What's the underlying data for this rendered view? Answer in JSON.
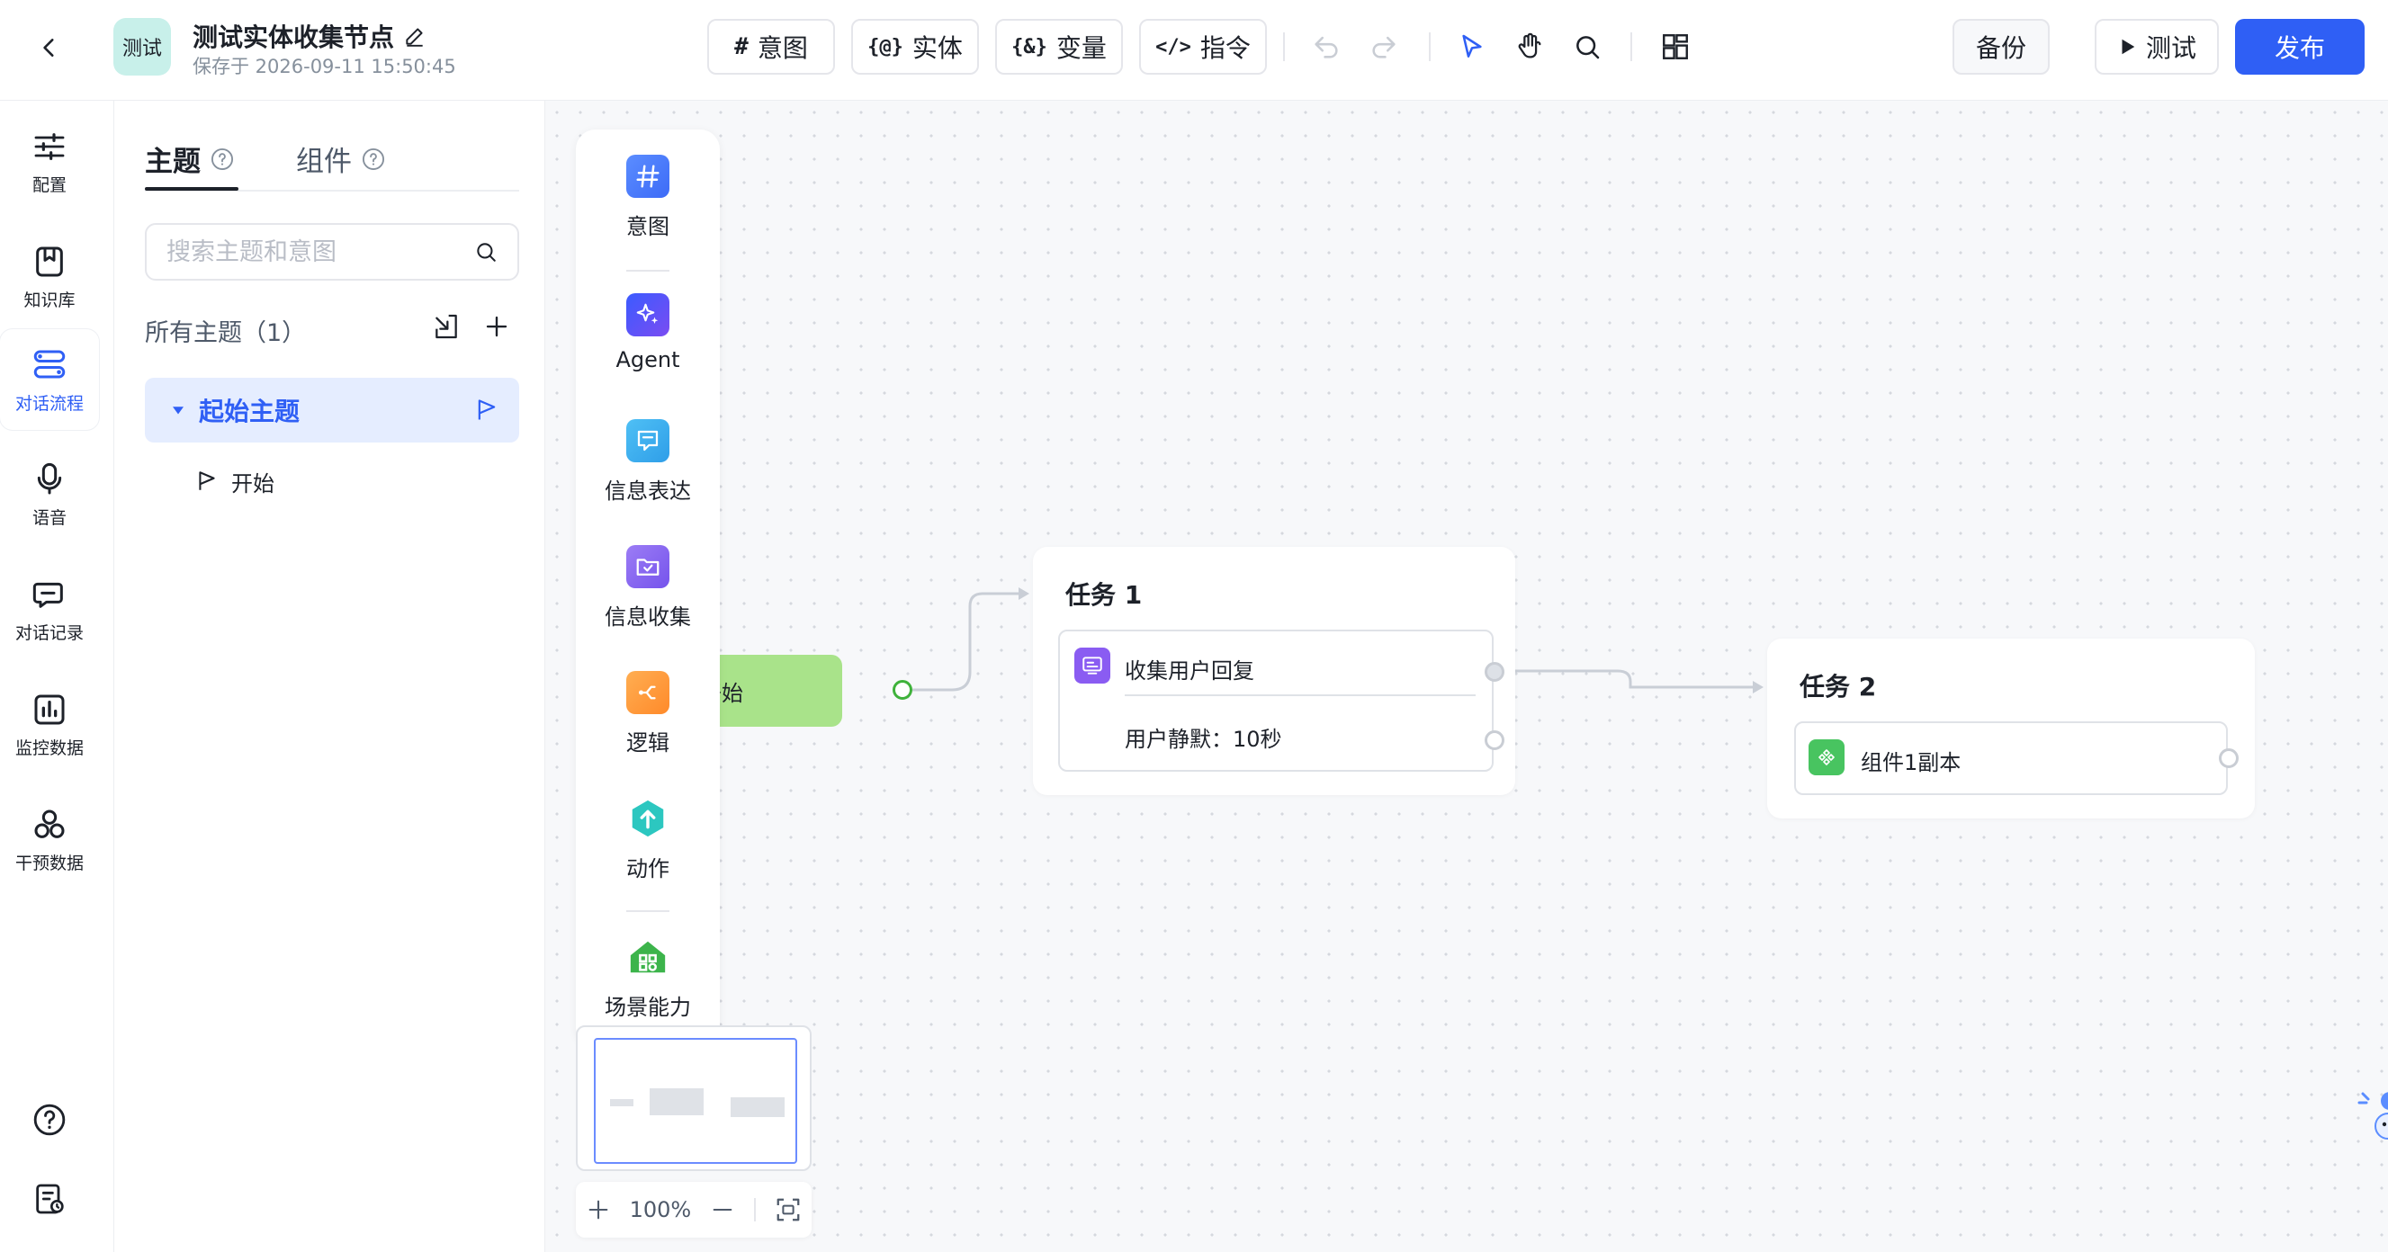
{
  "header": {
    "app_avatar_text": "测试",
    "app_name": "测试实体收集节点",
    "saved_at": "保存于 2026-09-11 15:50:45",
    "toolbar": {
      "intent_label": "意图",
      "intent_glyph": "#",
      "entity_label": "实体",
      "entity_glyph": "{@}",
      "variable_label": "变量",
      "variable_glyph": "{&}",
      "command_label": "指令",
      "command_glyph": "</>"
    },
    "backup_label": "备份",
    "test_label": "测试",
    "publish_label": "发布",
    "accent_color": "#2f5ff5"
  },
  "rail": {
    "items": [
      {
        "label": "配置",
        "icon": "sliders-icon"
      },
      {
        "label": "知识库",
        "icon": "bookmark-icon"
      },
      {
        "label": "对话流程",
        "icon": "flow-icon",
        "active": true
      },
      {
        "label": "语音",
        "icon": "microphone-icon"
      },
      {
        "label": "对话记录",
        "icon": "chat-icon"
      },
      {
        "label": "监控数据",
        "icon": "chart-icon"
      },
      {
        "label": "干预数据",
        "icon": "circles-icon"
      }
    ]
  },
  "panel": {
    "tabs": [
      {
        "label": "主题",
        "active": true
      },
      {
        "label": "组件",
        "active": false
      }
    ],
    "search_placeholder": "搜索主题和意图",
    "section_title": "所有主题（1）",
    "topic": "起始主题",
    "intent": "开始"
  },
  "palette": {
    "items": [
      {
        "label": "意图",
        "icon": "hash-icon",
        "color": "#4d7cff"
      },
      {
        "label": "Agent",
        "icon": "sparkle-icon",
        "color": "#3b5bff"
      },
      {
        "label": "信息表达",
        "icon": "message-icon",
        "color": "#3aa8f0"
      },
      {
        "label": "信息收集",
        "icon": "folder-check-icon",
        "color": "#8a6cf2"
      },
      {
        "label": "逻辑",
        "icon": "branch-icon",
        "color": "#ff9d3c"
      },
      {
        "label": "动作",
        "icon": "action-hex-icon",
        "color": "#2cc7c0"
      },
      {
        "label": "场景能力",
        "icon": "scene-house-icon",
        "color": "#3cb44b"
      }
    ]
  },
  "flow": {
    "start_label": "开始",
    "task1": {
      "title": "任务 1",
      "collect_label": "收集用户回复",
      "silence_label": "用户静默：10秒"
    },
    "task2": {
      "title": "任务 2",
      "component_label": "组件1副本"
    }
  },
  "zoom": {
    "level": "100%"
  }
}
